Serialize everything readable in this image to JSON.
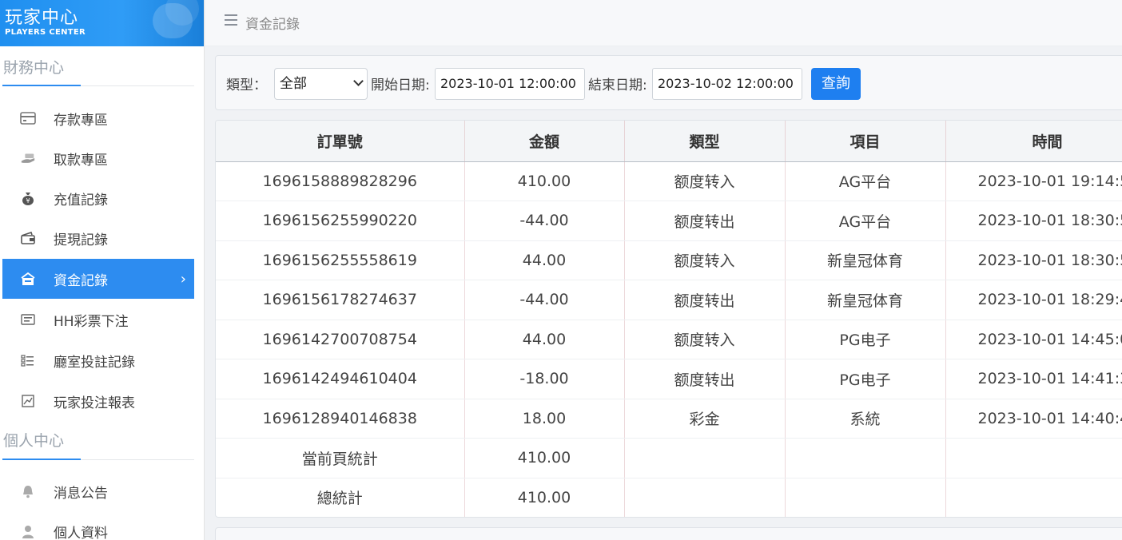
{
  "brand": {
    "title": "玩家中心",
    "subtitle": "PLAYERS CENTER"
  },
  "sidebar": {
    "finance_title": "財務中心",
    "finance_items": [
      {
        "label": "存款專區",
        "icon": "card-icon"
      },
      {
        "label": "取款專區",
        "icon": "cash-hand-icon"
      },
      {
        "label": "充值記錄",
        "icon": "money-bag-icon"
      },
      {
        "label": "提現記錄",
        "icon": "wallet-icon"
      },
      {
        "label": "資金記錄",
        "icon": "funds-icon",
        "active": true
      },
      {
        "label": "HH彩票下注",
        "icon": "ticket-icon"
      },
      {
        "label": "廳室投註記錄",
        "icon": "list-icon"
      },
      {
        "label": "玩家投注報表",
        "icon": "chart-icon"
      }
    ],
    "personal_title": "個人中心",
    "personal_items": [
      {
        "label": "消息公告",
        "icon": "bell-icon"
      },
      {
        "label": "個人資料",
        "icon": "user-icon"
      }
    ],
    "active_chevron": "›"
  },
  "header": {
    "title": "資金記錄"
  },
  "filter": {
    "type_label": "類型：",
    "type_value": "全部",
    "start_label": "開始日期:",
    "start_value": "2023-10-01 12:00:00",
    "end_label": "結束日期:",
    "end_value": "2023-10-02 12:00:00",
    "query_label": "查詢"
  },
  "table": {
    "headers": [
      "訂單號",
      "金額",
      "類型",
      "項目",
      "時間"
    ],
    "rows": [
      [
        "1696158889828296",
        "410.00",
        "额度转入",
        "AG平台",
        "2023-10-01 19:14:5"
      ],
      [
        "1696156255990220",
        "-44.00",
        "额度转出",
        "AG平台",
        "2023-10-01 18:30:5"
      ],
      [
        "1696156255558619",
        "44.00",
        "额度转入",
        "新皇冠体育",
        "2023-10-01 18:30:5"
      ],
      [
        "1696156178274637",
        "-44.00",
        "额度转出",
        "新皇冠体育",
        "2023-10-01 18:29:4"
      ],
      [
        "1696142700708754",
        "44.00",
        "额度转入",
        "PG电子",
        "2023-10-01 14:45:0"
      ],
      [
        "1696142494610404",
        "-18.00",
        "额度转出",
        "PG电子",
        "2023-10-01 14:41:3"
      ],
      [
        "1696128940146838",
        "18.00",
        "彩金",
        "系統",
        "2023-10-01 14:40:4"
      ]
    ],
    "summary": [
      {
        "label": "當前頁統計",
        "amount": "410.00"
      },
      {
        "label": "總統計",
        "amount": "410.00"
      }
    ]
  }
}
